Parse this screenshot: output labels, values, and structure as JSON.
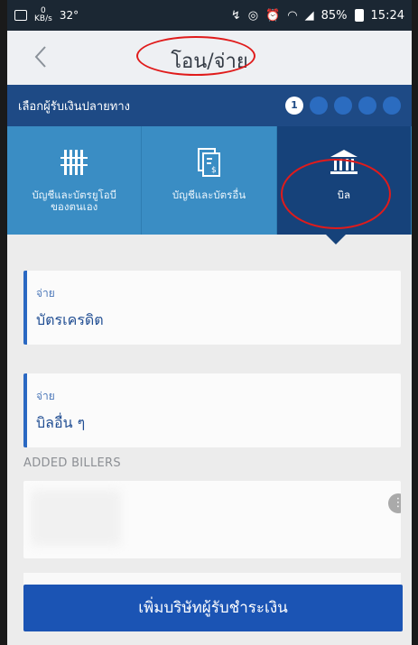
{
  "status_bar": {
    "speed_value": "0",
    "speed_unit": "KB/s",
    "temperature": "32°",
    "battery": "85%",
    "time": "15:24"
  },
  "header": {
    "back_icon": "chevron-left-icon",
    "title": "โอน/จ่าย"
  },
  "step_bar": {
    "label": "เลือกผู้รับเงินปลายทาง",
    "current_step": "1",
    "total_steps": 5
  },
  "tabs": [
    {
      "label": "บัญชีและบัตรยูโอบีของตนเอง",
      "icon": "bars-icon"
    },
    {
      "label": "บัญชีและบัตรอื่น",
      "icon": "document-dollar-icon"
    },
    {
      "label": "บิล",
      "icon": "bank-icon"
    }
  ],
  "cards": [
    {
      "small": "จ่าย",
      "big": "บัตรเครดิต"
    },
    {
      "small": "จ่าย",
      "big": "บิลอื่น ๆ"
    }
  ],
  "added_billers": {
    "label": "ADDED BILLERS"
  },
  "bottom_button": {
    "label": "เพิ่มบริษัทผู้รับชำระเงิน"
  },
  "colors": {
    "header_blue": "#1e4a85",
    "tab_blue": "#3a8dc4",
    "tab_active": "#16427a",
    "annotation_red": "#e01b1b"
  }
}
